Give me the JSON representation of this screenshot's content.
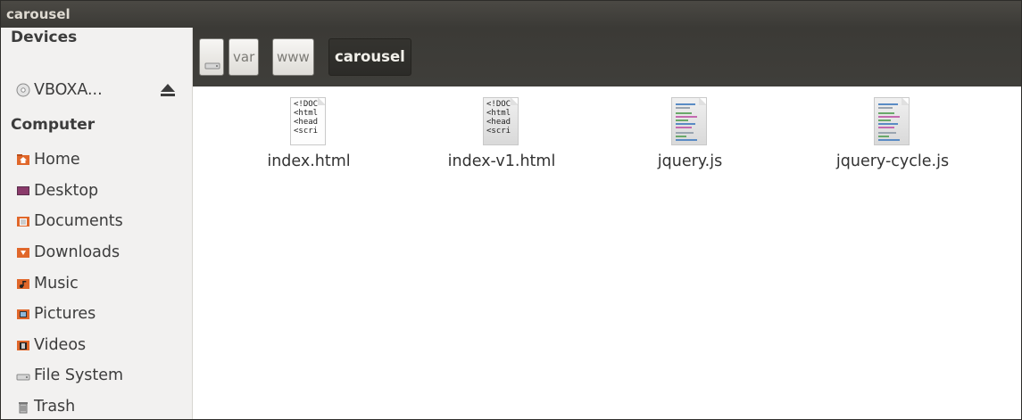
{
  "window": {
    "title": "carousel"
  },
  "sidebar": {
    "devices_header": "Devices",
    "devices": [
      {
        "label": "VBOXA...",
        "icon": "cdrom-icon"
      }
    ],
    "computer_header": "Computer",
    "places": [
      {
        "label": "Home",
        "icon": "home-folder-icon"
      },
      {
        "label": "Desktop",
        "icon": "desktop-icon"
      },
      {
        "label": "Documents",
        "icon": "documents-folder-icon"
      },
      {
        "label": "Downloads",
        "icon": "downloads-folder-icon"
      },
      {
        "label": "Music",
        "icon": "music-folder-icon"
      },
      {
        "label": "Pictures",
        "icon": "pictures-folder-icon"
      },
      {
        "label": "Videos",
        "icon": "videos-folder-icon"
      },
      {
        "label": "File System",
        "icon": "harddisk-icon"
      },
      {
        "label": "Trash",
        "icon": "trash-icon"
      }
    ]
  },
  "pathbar": {
    "root_icon": "harddisk-icon",
    "crumbs": [
      "var",
      "www",
      "carousel"
    ]
  },
  "files": [
    {
      "name": "index.html",
      "type": "html",
      "preview": [
        "<!DOC",
        "<html",
        "<head",
        "<scri"
      ]
    },
    {
      "name": "index-v1.html",
      "type": "html",
      "preview": [
        "<!DOC",
        "<html",
        "<head",
        "<scri"
      ]
    },
    {
      "name": "jquery.js",
      "type": "javascript"
    },
    {
      "name": "jquery-cycle.js",
      "type": "javascript"
    }
  ],
  "colors": {
    "titlebar": "#3c3b37",
    "selected_crumb": "#2f2e2a",
    "sidebar_bg": "#f2f1f0"
  }
}
